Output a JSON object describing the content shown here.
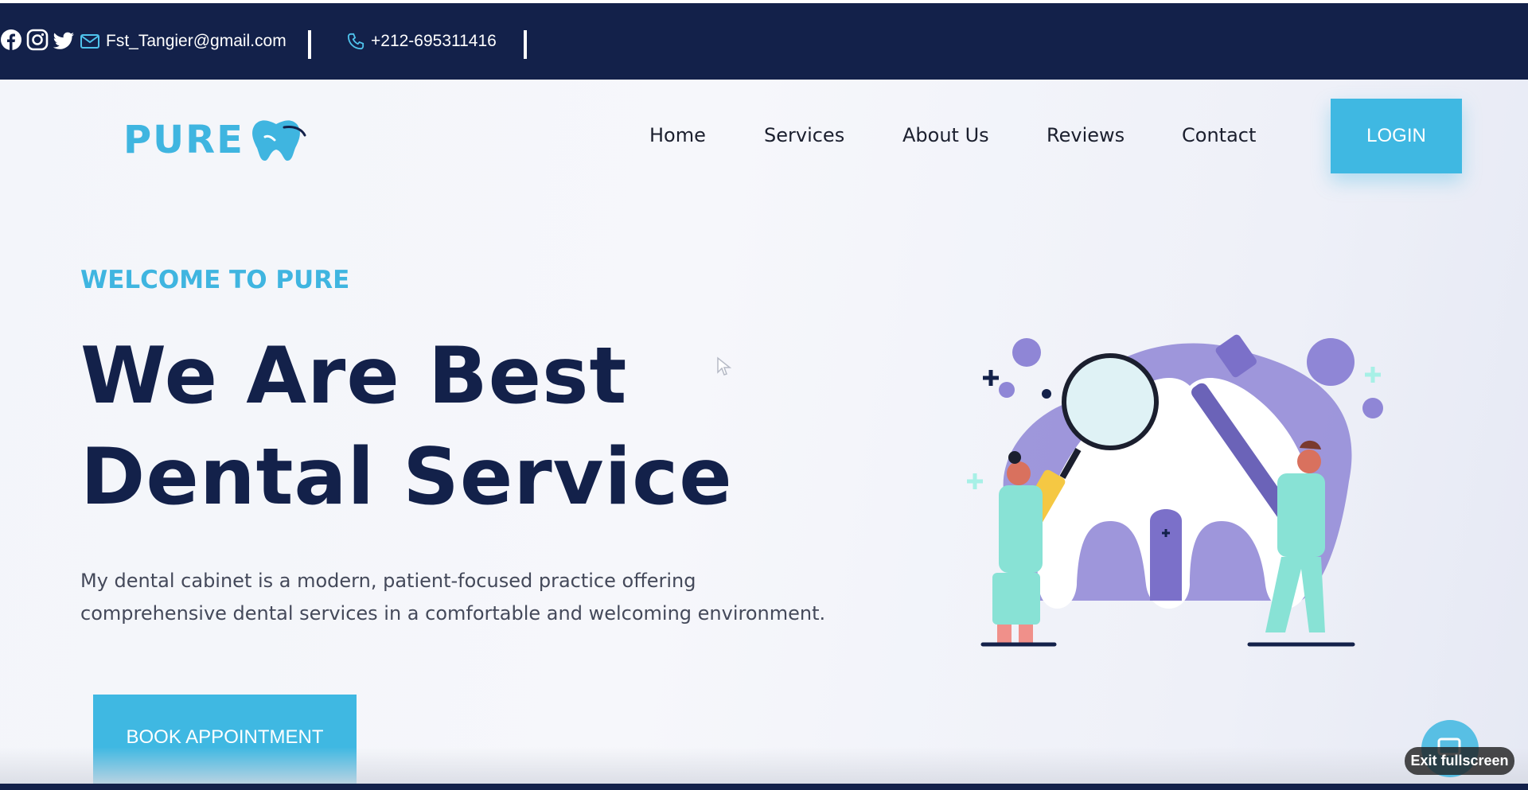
{
  "topbar": {
    "email": "Fst_Tangier@gmail.com",
    "phone": "+212-695311416",
    "social": [
      "facebook-icon",
      "instagram-icon",
      "twitter-icon"
    ]
  },
  "brand": {
    "name": "PURE",
    "accent": "#3fb5e0",
    "navy": "#13214a"
  },
  "nav": {
    "items": [
      {
        "label": "Home"
      },
      {
        "label": "Services"
      },
      {
        "label": "About Us"
      },
      {
        "label": "Reviews"
      },
      {
        "label": "Contact"
      }
    ],
    "login_label": "LOGIN"
  },
  "hero": {
    "eyebrow": "WELCOME TO PURE",
    "headline_line1": "We Are Best",
    "headline_line2": "Dental Service",
    "description": "My dental cabinet is a modern, patient-focused practice offering comprehensive dental services in a comfortable and welcoming environment.",
    "cta_label": "BOOK APPOINTMENT"
  },
  "overlay": {
    "exit_fullscreen": "Exit fullscreen"
  }
}
